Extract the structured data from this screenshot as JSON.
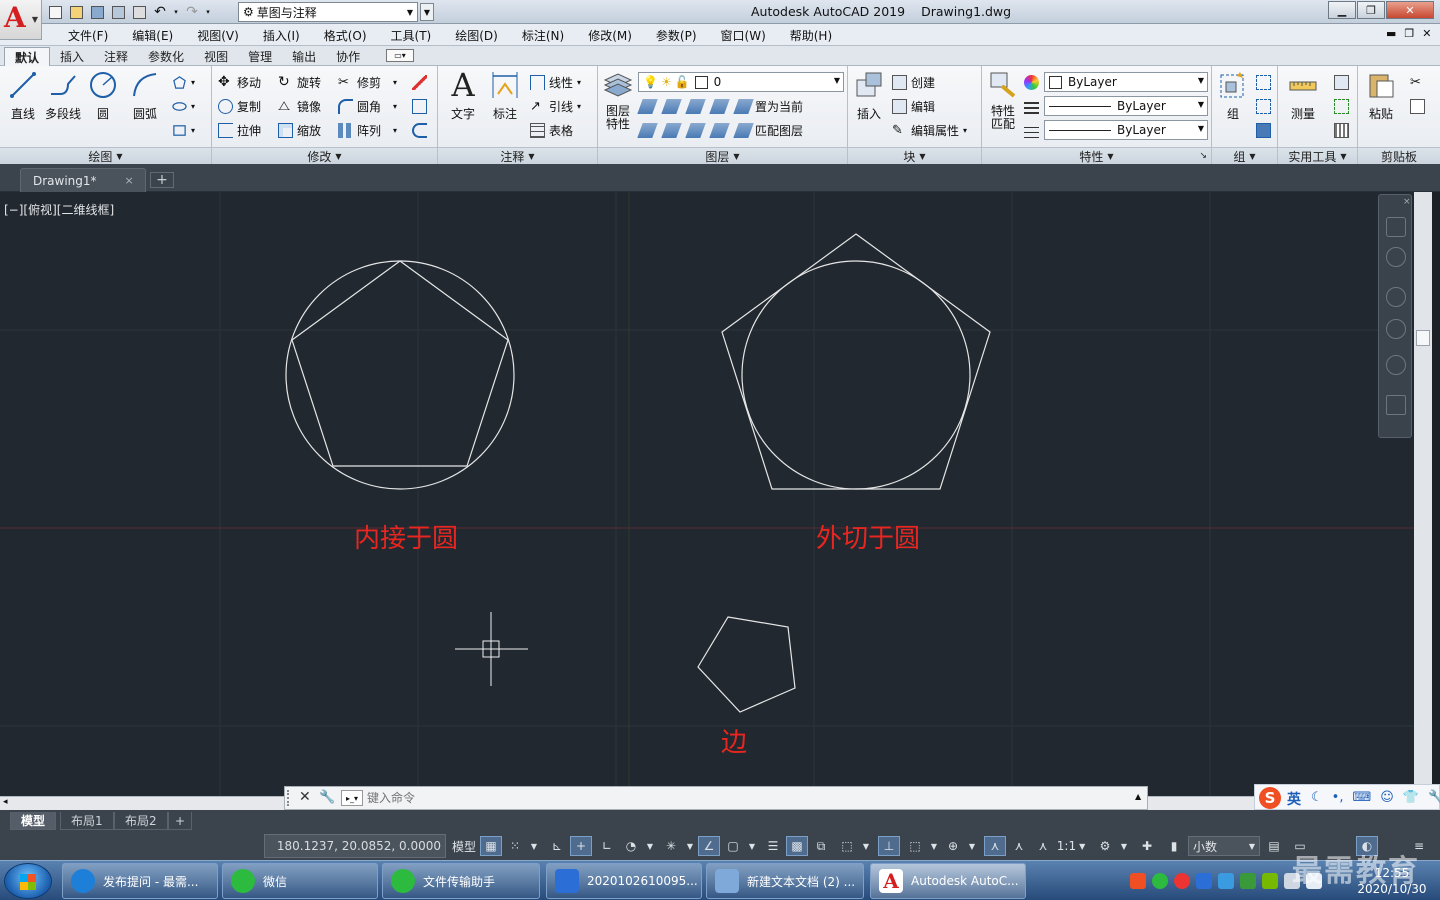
{
  "app": {
    "logo_letter": "A",
    "title": "Autodesk AutoCAD 2019",
    "filename": "Drawing1.dwg",
    "workspace": "草图与注释"
  },
  "menu": [
    "文件(F)",
    "编辑(E)",
    "视图(V)",
    "插入(I)",
    "格式(O)",
    "工具(T)",
    "绘图(D)",
    "标注(N)",
    "修改(M)",
    "参数(P)",
    "窗口(W)",
    "帮助(H)"
  ],
  "ribbon_tabs": [
    "默认",
    "插入",
    "注释",
    "参数化",
    "视图",
    "管理",
    "输出",
    "协作"
  ],
  "ribbon_tab_active": "默认",
  "panels": {
    "draw": {
      "title": "绘图",
      "line": "直线",
      "polyline": "多段线",
      "circle": "圆",
      "arc": "圆弧"
    },
    "modify": {
      "title": "修改",
      "move": "移动",
      "rotate": "旋转",
      "trim": "修剪",
      "copy": "复制",
      "mirror": "镜像",
      "fillet": "圆角",
      "stretch": "拉伸",
      "scale": "缩放",
      "array": "阵列"
    },
    "annotation": {
      "title": "注释",
      "text": "文字",
      "dimension": "标注",
      "linear": "线性",
      "leader": "引线",
      "table": "表格"
    },
    "layers": {
      "title": "图层",
      "layer_props": "图层\n特性",
      "layer_value": "0",
      "make_current": "置为当前",
      "match_layer": "匹配图层"
    },
    "block": {
      "title": "块",
      "insert": "插入",
      "create": "创建",
      "edit": "编辑",
      "edit_attr": "编辑属性"
    },
    "properties": {
      "title": "特性",
      "match": "特性\n匹配",
      "color": "ByLayer",
      "linetype": "ByLayer",
      "lineweight": "ByLayer"
    },
    "groups": {
      "title": "组",
      "group": "组"
    },
    "utilities": {
      "title": "实用工具",
      "measure": "测量"
    },
    "clipboard": {
      "title": "剪贴板",
      "paste": "粘贴"
    }
  },
  "file_tab": {
    "name": "Drawing1*",
    "close": "×",
    "add": "+"
  },
  "viewport_label": "[−][俯视][二维线框]",
  "drawing": {
    "label_inscribed": "内接于圆",
    "label_circumscribed": "外切于圆",
    "label_edge": "边",
    "label_color": "#e8261f",
    "line_color": "#e6e6e6"
  },
  "command": {
    "placeholder": "键入命令"
  },
  "layout_tabs": [
    "模型",
    "布局1",
    "布局2"
  ],
  "layout_tab_add": "+",
  "status": {
    "coords": "180.1237, 20.0852, 0.0000",
    "model": "模型",
    "scale": "1:1",
    "units": "小数"
  },
  "ime": {
    "logo": "S",
    "lang": "英"
  },
  "taskbar": {
    "items": [
      {
        "label": "发布提问 - 最需...",
        "color": "#1e7fd8"
      },
      {
        "label": "微信",
        "color": "#2dbb3f"
      },
      {
        "label": "文件传输助手",
        "color": "#2dbb3f"
      },
      {
        "label": "2020102610095...",
        "color": "#2b6fd6"
      },
      {
        "label": "新建文本文档 (2) ...",
        "color": "#7fa9d8"
      },
      {
        "label": "Autodesk AutoC...",
        "color": "#d31f1f"
      }
    ],
    "time": "12:55",
    "date": "2020/10/30"
  },
  "watermark": "最需教育"
}
